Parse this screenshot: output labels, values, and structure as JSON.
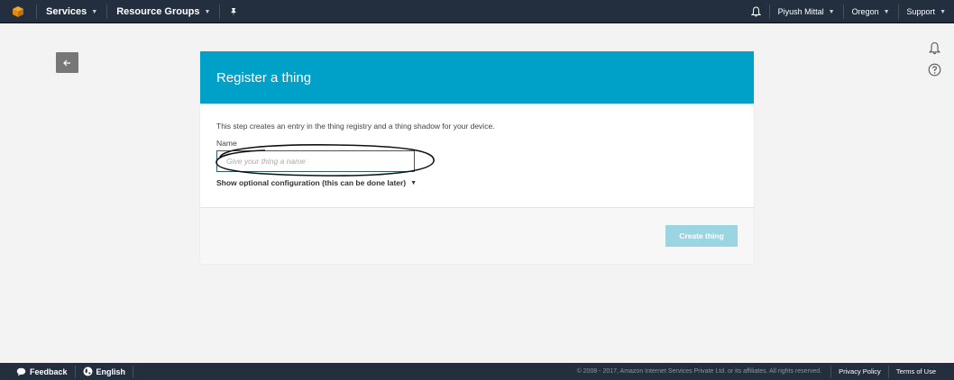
{
  "topnav": {
    "logo_icon": "aws-cube-icon",
    "services_label": "Services",
    "resource_groups_label": "Resource Groups",
    "pin_icon": "pin-icon",
    "bell_icon": "bell-icon",
    "user_label": "Piyush Mittal",
    "region_label": "Oregon",
    "support_label": "Support"
  },
  "back_button": {
    "icon": "arrow-left-icon"
  },
  "side_icons": [
    "bell-icon",
    "help-icon"
  ],
  "card": {
    "title": "Register a thing",
    "description": "This step creates an entry in the thing registry and a thing shadow for your device.",
    "name_label": "Name",
    "name_placeholder": "Give your thing a name",
    "name_value": "",
    "optional_config_label": "Show optional configuration (this can be done later)",
    "create_button_label": "Create thing",
    "header_color": "#00a1c9",
    "button_color": "#9bd5e4"
  },
  "footer": {
    "feedback_label": "Feedback",
    "language_label": "English",
    "copyright": "© 2008 - 2017, Amazon Internet Services Private Ltd. or its affiliates. All rights reserved.",
    "privacy_label": "Privacy Policy",
    "terms_label": "Terms of Use"
  }
}
